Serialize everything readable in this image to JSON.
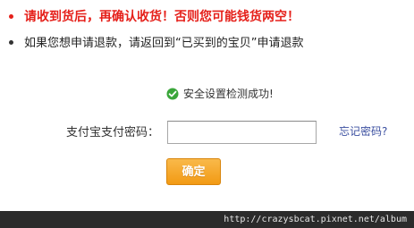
{
  "notices": {
    "warning": "请收到货后，再确认收货！否则您可能钱货两空！",
    "info": "如果您想申请退款，请返回到“已买到的宝贝”申请退款"
  },
  "status": {
    "message": "安全设置检测成功!",
    "icon": "check-circle-icon",
    "icon_color": "#3aa63a"
  },
  "form": {
    "password_label": "支付宝支付密码：",
    "password_value": "",
    "forgot_link": "忘记密码?",
    "confirm_button": "确定"
  },
  "colors": {
    "warning": "#e5201a",
    "link": "#3b4fa0",
    "button": "#f29a14"
  },
  "watermark": {
    "text": "http://crazysbcat.pixnet.net/album"
  }
}
